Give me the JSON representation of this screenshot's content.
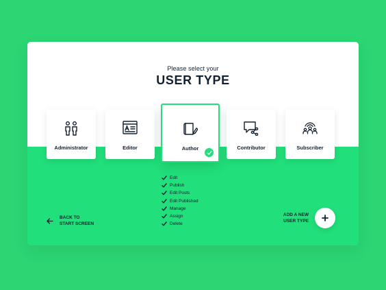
{
  "header": {
    "subtitle": "Please select your",
    "title": "USER TYPE"
  },
  "roles": [
    {
      "label": "Administrator",
      "icon": "users-icon",
      "selected": false
    },
    {
      "label": "Editor",
      "icon": "document-icon",
      "selected": false
    },
    {
      "label": "Author",
      "icon": "notebook-pen-icon",
      "selected": true
    },
    {
      "label": "Contributor",
      "icon": "chat-share-icon",
      "selected": false
    },
    {
      "label": "Subscriber",
      "icon": "broadcast-users-icon",
      "selected": false
    }
  ],
  "permissions": [
    "Edit",
    "Publish",
    "Edit Posts",
    "Edit Published",
    "Manage",
    "Assign",
    "Delete"
  ],
  "back": {
    "line1": "BACK TO",
    "line2": "START SCREEN"
  },
  "add": {
    "line1": "ADD A NEW",
    "line2": "USER TYPE"
  },
  "colors": {
    "accent": "#21df7a",
    "background": "#2bd673",
    "text": "#13202e"
  }
}
